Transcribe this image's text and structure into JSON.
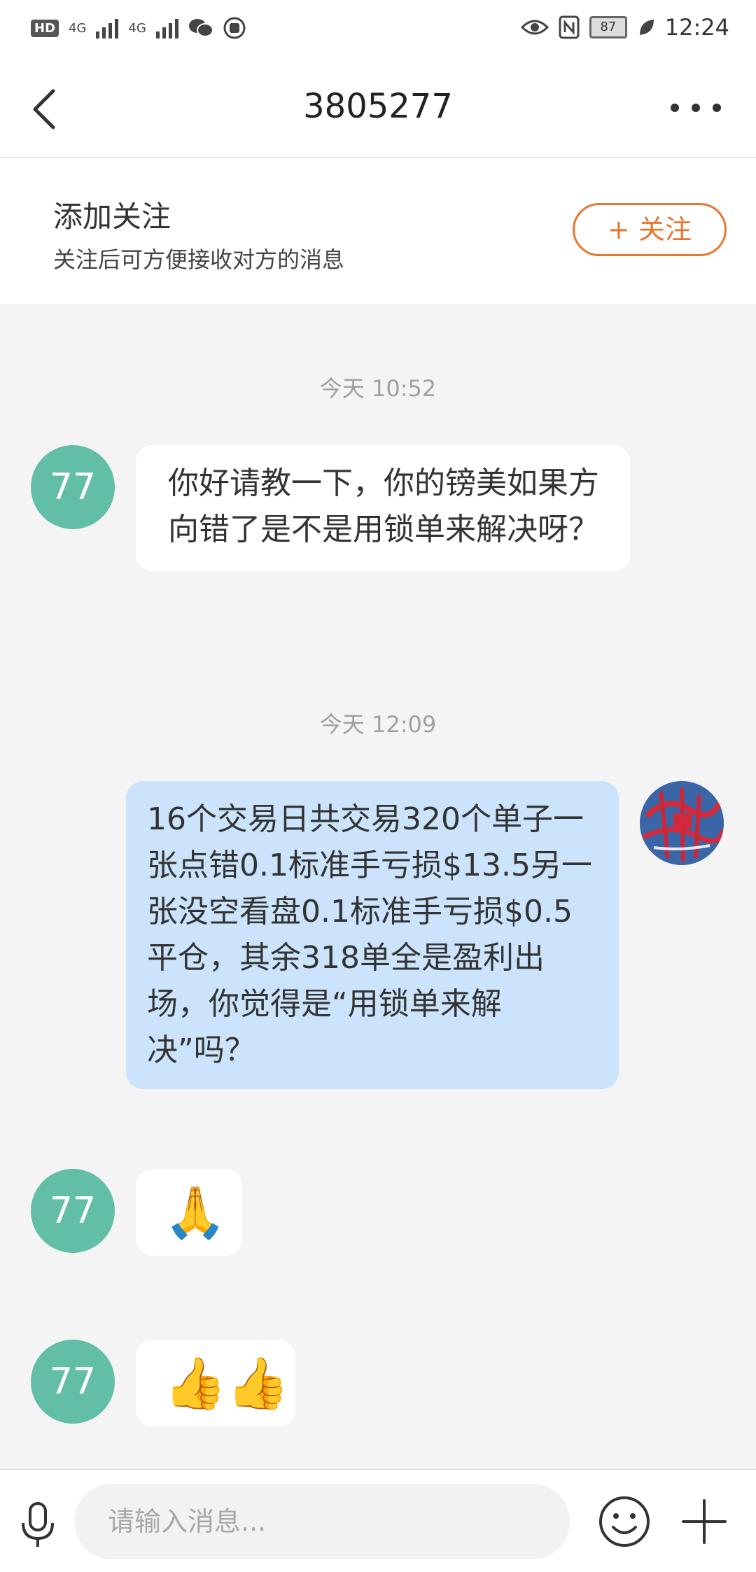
{
  "status_bar": {
    "hd": "HD",
    "sim1": "4G",
    "sim2": "4G",
    "battery": "87",
    "time": "12:24"
  },
  "header": {
    "title": "3805277"
  },
  "follow_banner": {
    "title": "添加关注",
    "subtitle": "关注后可方便接收对方的消息",
    "button_label": "+ 关注"
  },
  "messages": [
    {
      "timestamp": "今天 10:52"
    },
    {
      "sender_avatar": "77",
      "text": "你好请教一下，你的镑美如果方向错了是不是用锁单来解决呀？"
    },
    {
      "timestamp": "今天 12:09"
    },
    {
      "text": "16个交易日共交易320个单子一张点错0.1标准手亏损$13.5另一张没空看盘0.1标准手亏损$0.5平仓，其余318单全是盈利出场，你觉得是“用锁单来解决”吗？"
    },
    {
      "sender_avatar": "77",
      "emoji": "🙏"
    },
    {
      "sender_avatar": "77",
      "emoji": "👍👍"
    }
  ],
  "input_bar": {
    "placeholder": "请输入消息..."
  },
  "colors": {
    "accent": "#e8762c",
    "avatar": "#62bea6",
    "outgoing_bubble": "#cbe4fb",
    "chat_background": "#f4f4f4"
  }
}
